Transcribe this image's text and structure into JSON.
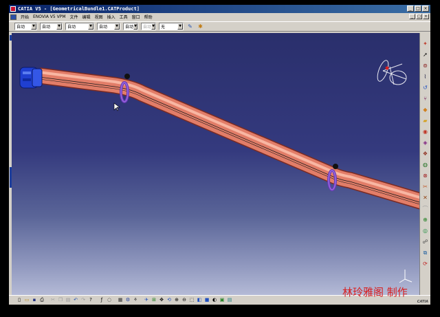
{
  "window": {
    "title": "CATIA V5 - [GeometricalBundle1.CATProduct]",
    "minimize": "_",
    "restore": "□",
    "close": "×"
  },
  "menubar": {
    "items": [
      "开始",
      "ENOVIA V5 VPM",
      "文件",
      "编辑",
      "视图",
      "插入",
      "工具",
      "窗口",
      "帮助"
    ]
  },
  "format_toolbar": {
    "combos": [
      {
        "value": "自动",
        "disabled": false
      },
      {
        "value": "自动",
        "disabled": false
      },
      {
        "value": "自动",
        "disabled": false
      },
      {
        "value": "自动",
        "disabled": false
      },
      {
        "value": "自动",
        "disabled": false
      },
      {
        "value": "自动",
        "disabled": true
      },
      {
        "value": "无",
        "disabled": false
      }
    ]
  },
  "right_toolbar": {
    "icons": [
      "compass-icon",
      "select-arrow-icon",
      "bundle-icon",
      "segment-icon",
      "hook-icon",
      "branch-icon",
      "route-icon",
      "folder-icon",
      "connector-icon",
      "support-icon",
      "protection-icon",
      "clamp-icon",
      "flatten-icon",
      "join-icon",
      "split-icon",
      "add-point-icon",
      "bend-icon",
      "check-icon",
      "analysis-icon",
      "bundle-continuity-icon",
      "update-icon"
    ]
  },
  "bottom_toolbar": {
    "icons": [
      "new-icon",
      "open-icon",
      "save-icon",
      "print-icon",
      "cut-icon",
      "copy-icon",
      "paste-icon",
      "undo-icon",
      "redo-icon",
      "whats-this-icon",
      "formula-icon",
      "comment-icon",
      "catalog-icon",
      "product-icon",
      "constraint-icon",
      "fly-icon",
      "fit-all-icon",
      "pan-icon",
      "rotate-icon",
      "zoom-in-icon",
      "zoom-out-icon",
      "normal-view-icon",
      "iso-view-icon",
      "shading-icon",
      "hide-show-icon",
      "swap-space-icon",
      "measure-icon"
    ]
  },
  "branding": {
    "logo": "CATIA",
    "watermark": "林玲雅阁 制作"
  }
}
